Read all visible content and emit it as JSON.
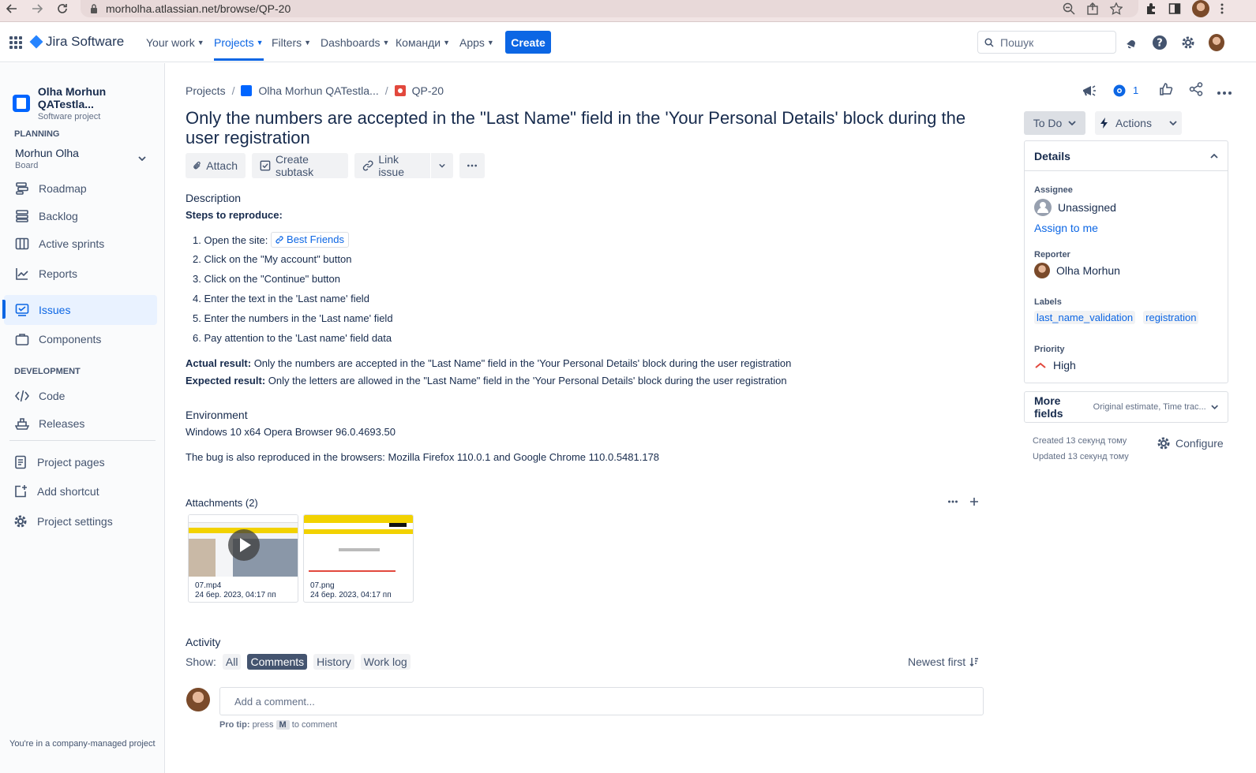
{
  "browser": {
    "url": "morholha.atlassian.net/browse/QP-20"
  },
  "topnav": {
    "product": "Jira Software",
    "items": [
      "Your work",
      "Projects",
      "Filters",
      "Dashboards",
      "Команди",
      "Apps"
    ],
    "create": "Create",
    "search_placeholder": "Пошук"
  },
  "sidebar": {
    "project_name": "Olha Morhun QATestla...",
    "project_type": "Software project",
    "planning_title": "PLANNING",
    "board_name": "Morhun Olha",
    "board_sub": "Board",
    "planning_items": [
      "Roadmap",
      "Backlog",
      "Active sprints",
      "Reports"
    ],
    "issues": "Issues",
    "components": "Components",
    "development_title": "DEVELOPMENT",
    "dev_items": [
      "Code",
      "Releases"
    ],
    "footer_items": [
      "Project pages",
      "Add shortcut",
      "Project settings"
    ],
    "note": "You're in a company-managed project"
  },
  "breadcrumb": {
    "projects": "Projects",
    "project": "Olha Morhun QATestla...",
    "issue_key": "QP-20"
  },
  "issue": {
    "title": "Only the numbers are accepted in the \"Last Name\" field in the 'Your Personal Details' block during the user registration",
    "actions": {
      "attach": "Attach",
      "create_subtask": "Create subtask",
      "link_issue": "Link issue"
    },
    "description_label": "Description",
    "steps_title": "Steps to reproduce:",
    "step1_prefix": "1. Open the site:",
    "step1_link": "Best Friends",
    "steps": [
      "2. Click on the \"My account\" button",
      "3. Click on the \"Continue\" button",
      "4. Enter the text in the 'Last name' field",
      "5. Enter the numbers in the 'Last name' field",
      "6. Pay attention to the 'Last name' field data"
    ],
    "actual_label": "Actual result:",
    "actual_text": " Only the numbers are accepted in the \"Last Name\" field in the 'Your Personal Details' block during the user registration",
    "expected_label": "Expected result:",
    "expected_text": " Only the letters are allowed in the \"Last Name\" field in the 'Your Personal Details' block during the user registration",
    "environment_label": "Environment",
    "environment_line1": "Windows 10 x64 Opera Browser 96.0.4693.50",
    "environment_line2": "The bug is also reproduced in the browsers: Mozilla Firefox 110.0.1 and Google Chrome 110.0.5481.178",
    "attachments_label": "Attachments (2)",
    "attachments": [
      {
        "name": "07.mp4",
        "date": "24 бер. 2023, 04:17 пп"
      },
      {
        "name": "07.png",
        "date": "24 бер. 2023, 04:17 пп"
      }
    ],
    "activity_label": "Activity",
    "show_label": "Show:",
    "activity_tabs": [
      "All",
      "Comments",
      "History",
      "Work log"
    ],
    "sort_label": "Newest first",
    "comment_placeholder": "Add a comment...",
    "protip_label": "Pro tip:",
    "protip_press": "press",
    "protip_key": "M",
    "protip_rest": "to comment"
  },
  "right": {
    "watch_count": "1",
    "status": "To Do",
    "actions": "Actions",
    "details": "Details",
    "assignee_label": "Assignee",
    "assignee": "Unassigned",
    "assign_to_me": "Assign to me",
    "reporter_label": "Reporter",
    "reporter": "Olha Morhun",
    "labels_label": "Labels",
    "labels": [
      "last_name_validation",
      "registration"
    ],
    "priority_label": "Priority",
    "priority": "High",
    "more_fields": "More fields",
    "more_fields_hint": "Original estimate, Time trac...",
    "created": "Created 13 секунд тому",
    "updated": "Updated 13 секунд тому",
    "configure": "Configure"
  },
  "colors": {
    "accent": "#0c66e4",
    "priority_high": "#e2483d"
  }
}
